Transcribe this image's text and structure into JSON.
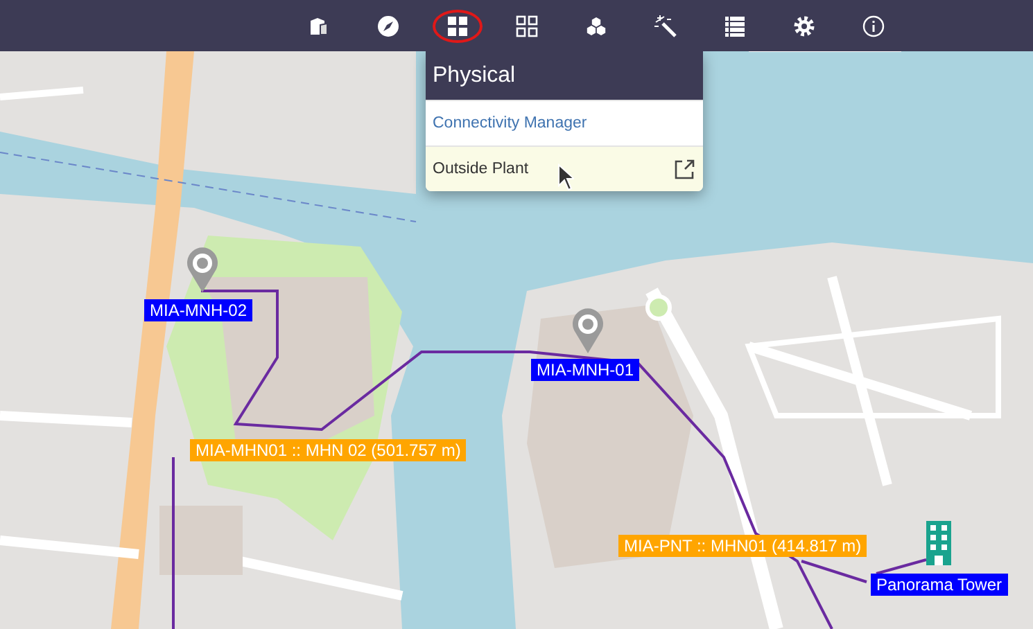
{
  "toolbar": {
    "items": [
      {
        "kind": "buildings",
        "selected": false
      },
      {
        "kind": "compass",
        "selected": false
      },
      {
        "kind": "grid-filled",
        "selected": true
      },
      {
        "kind": "grid-outline",
        "selected": false
      },
      {
        "kind": "cubes",
        "selected": false
      },
      {
        "kind": "wand",
        "selected": false
      },
      {
        "kind": "list",
        "selected": false
      },
      {
        "kind": "gear",
        "selected": false
      },
      {
        "kind": "info",
        "selected": false
      }
    ]
  },
  "menu": {
    "title": "Physical",
    "items": [
      {
        "label": "Connectivity Manager",
        "kind": "link",
        "selected": false
      },
      {
        "label": "Outside Plant",
        "kind": "external",
        "selected": true
      }
    ]
  },
  "map": {
    "labels": [
      {
        "text": "MIA-MNH-02",
        "color": "#0000ff"
      },
      {
        "text": "MIA-MNH-01",
        "color": "#0000ff"
      },
      {
        "text": "MIA-MHN01 :: MHN 02  (501.757 m)",
        "color": "#ffa500"
      },
      {
        "text": "MIA-PNT :: MHN01  (414.817 m)",
        "color": "#ffa500"
      },
      {
        "text": "Panorama Tower",
        "color": "#0000ff"
      }
    ]
  }
}
